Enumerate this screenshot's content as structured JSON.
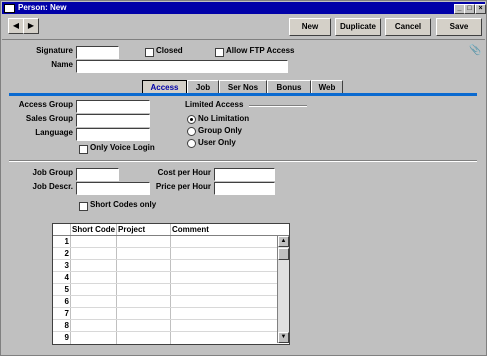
{
  "window": {
    "title": "Person: New"
  },
  "toolbar": {
    "new": "New",
    "duplicate": "Duplicate",
    "cancel": "Cancel",
    "save": "Save"
  },
  "header": {
    "signature_label": "Signature",
    "closed_label": "Closed",
    "ftp_label": "Allow FTP Access",
    "name_label": "Name"
  },
  "tabs": [
    "Access",
    "Job",
    "Ser Nos",
    "Bonus",
    "Web"
  ],
  "access": {
    "access_group_label": "Access Group",
    "sales_group_label": "Sales Group",
    "language_label": "Language",
    "voice_login_label": "Only Voice Login",
    "limited_access_label": "Limited Access",
    "radio_no_limit": "No Limitation",
    "radio_group_only": "Group Only",
    "radio_user_only": "User Only"
  },
  "job": {
    "job_group_label": "Job Group",
    "job_descr_label": "Job Descr.",
    "cost_per_hour_label": "Cost per Hour",
    "price_per_hour_label": "Price per Hour",
    "short_codes_only_label": "Short Codes only"
  },
  "grid": {
    "columns": [
      "Short Code",
      "Project",
      "Comment"
    ],
    "rows": [
      "1",
      "2",
      "3",
      "4",
      "5",
      "6",
      "7",
      "8",
      "9"
    ]
  }
}
